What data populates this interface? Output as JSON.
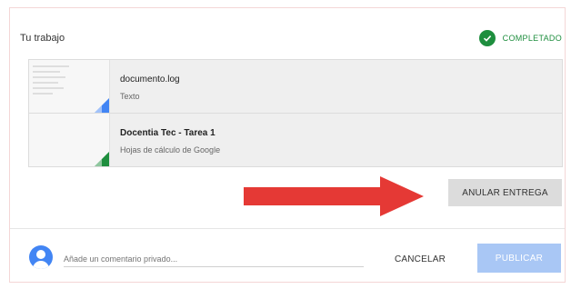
{
  "card": {
    "title": "Tu trabajo",
    "status_label": "COMPLETADO",
    "status_icon": "check-circle-icon",
    "status_color": "#1e8e3e"
  },
  "files": [
    {
      "name": "documento.log",
      "type": "Texto",
      "icon": "docs-corner-icon",
      "accent": "#4285f4"
    },
    {
      "name": "Docentia Tec - Tarea 1",
      "type": "Hojas de cálculo de Google",
      "icon": "sheets-corner-icon",
      "accent": "#1e8e3e"
    }
  ],
  "actions": {
    "unsubmit_label": "ANULAR ENTREGA"
  },
  "comment": {
    "placeholder": "Añade un comentario privado...",
    "cancel_label": "CANCELAR",
    "publish_label": "PUBLICAR"
  },
  "annotation": {
    "arrow_color": "#e53935"
  }
}
